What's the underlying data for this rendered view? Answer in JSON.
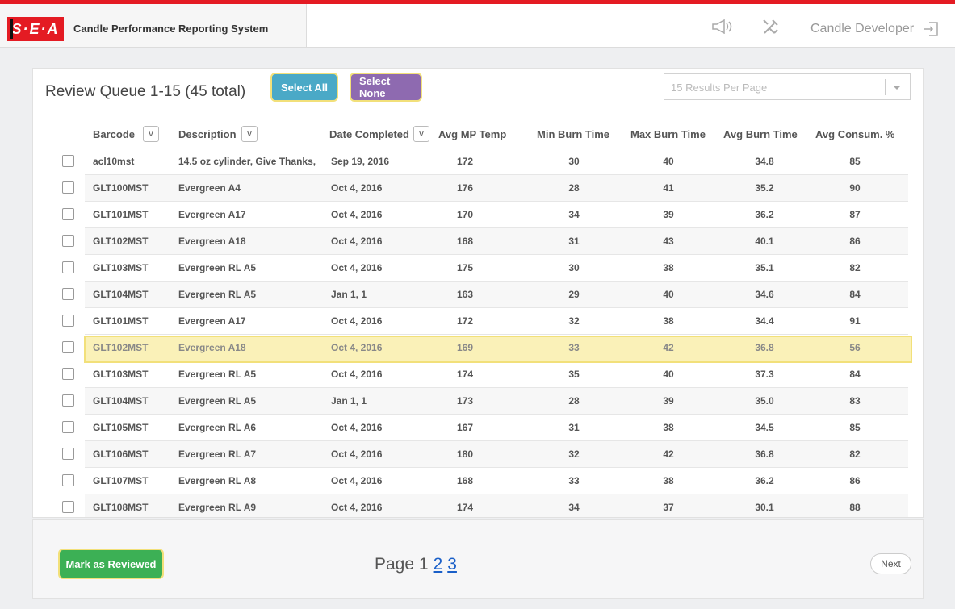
{
  "header": {
    "logo_text": "S·E·A",
    "app_title": "Candle Performance Reporting System",
    "user_name": "Candle Developer",
    "icons": [
      "megaphone-icon",
      "tools-icon",
      "logout-icon"
    ]
  },
  "queue": {
    "title": "Review Queue 1-15 (45 total)",
    "select_all_label": "Select All",
    "select_none_label": "Select None",
    "per_page_placeholder": "15 Results Per Page"
  },
  "table": {
    "columns": [
      {
        "label": "Barcode",
        "sortable": true
      },
      {
        "label": "Description",
        "sortable": true
      },
      {
        "label": "Date Completed",
        "sortable": true
      },
      {
        "label": "Avg MP Temp"
      },
      {
        "label": "Min Burn Time"
      },
      {
        "label": "Max Burn Time"
      },
      {
        "label": "Avg Burn Time"
      },
      {
        "label": "Avg Consum. %"
      }
    ],
    "sort_glyph": "v",
    "rows": [
      [
        "acl10mst",
        "14.5 oz cylinder, Give Thanks,",
        "Sep 19, 2016",
        "172",
        "30",
        "40",
        "34.8",
        "85"
      ],
      [
        "GLT100MST",
        "Evergreen A4",
        "Oct 4, 2016",
        "176",
        "28",
        "41",
        "35.2",
        "90"
      ],
      [
        "GLT101MST",
        "Evergreen A17",
        "Oct 4, 2016",
        "170",
        "34",
        "39",
        "36.2",
        "87"
      ],
      [
        "GLT102MST",
        "Evergreen A18",
        "Oct 4, 2016",
        "168",
        "31",
        "43",
        "40.1",
        "86"
      ],
      [
        "GLT103MST",
        "Evergreen RL A5",
        "Oct 4, 2016",
        "175",
        "30",
        "38",
        "35.1",
        "82"
      ],
      [
        "GLT104MST",
        "Evergreen RL A5",
        "Jan 1, 1",
        "163",
        "29",
        "40",
        "34.6",
        "84"
      ],
      [
        "GLT101MST",
        "Evergreen A17",
        "Oct 4, 2016",
        "172",
        "32",
        "38",
        "34.4",
        "91"
      ],
      [
        "GLT102MST",
        "Evergreen A18",
        "Oct 4, 2016",
        "169",
        "33",
        "42",
        "36.8",
        "56"
      ],
      [
        "GLT103MST",
        "Evergreen RL A5",
        "Oct 4, 2016",
        "174",
        "35",
        "40",
        "37.3",
        "84"
      ],
      [
        "GLT104MST",
        "Evergreen RL A5",
        "Jan 1, 1",
        "173",
        "28",
        "39",
        "35.0",
        "83"
      ],
      [
        "GLT105MST",
        "Evergreen RL A6",
        "Oct 4, 2016",
        "167",
        "31",
        "38",
        "34.5",
        "85"
      ],
      [
        "GLT106MST",
        "Evergreen RL A7",
        "Oct 4, 2016",
        "180",
        "32",
        "42",
        "36.8",
        "82"
      ],
      [
        "GLT107MST",
        "Evergreen RL A8",
        "Oct 4, 2016",
        "168",
        "33",
        "38",
        "36.2",
        "86"
      ],
      [
        "GLT108MST",
        "Evergreen RL A9",
        "Oct 4, 2016",
        "174",
        "34",
        "37",
        "30.1",
        "88"
      ]
    ],
    "highlighted_row_index": 7
  },
  "footer": {
    "mark_reviewed_label": "Mark as Reviewed",
    "page_label": "Page 1",
    "page_links": [
      "2",
      "3"
    ],
    "next_label": "Next"
  },
  "colors": {
    "brand_red": "#e41b23",
    "select_all": "#4aa9c7",
    "select_none": "#8e6ab0",
    "mark_reviewed": "#3cb055",
    "highlight": "#faf1b8",
    "focus_border": "#f2e07a"
  }
}
